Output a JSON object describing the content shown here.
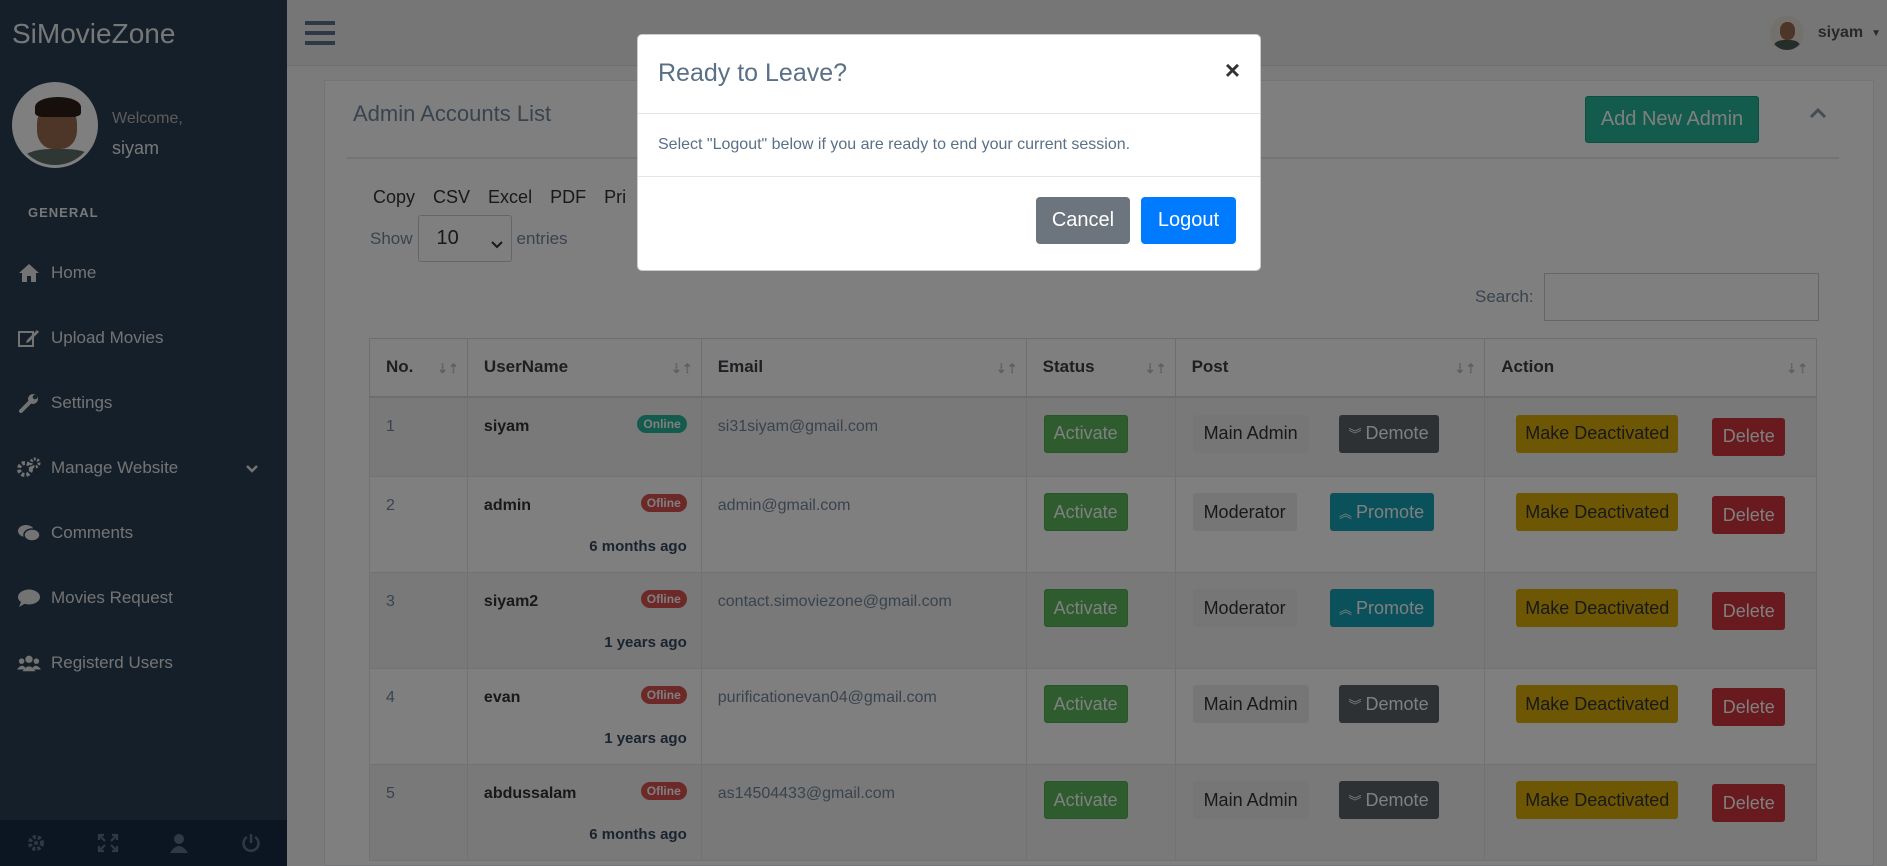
{
  "sidebar": {
    "brand": "SiMovieZone",
    "welcome": "Welcome,",
    "username": "siyam",
    "section_title": "GENERAL",
    "items": [
      {
        "label": "Home",
        "icon": "home-icon"
      },
      {
        "label": "Upload Movies",
        "icon": "edit-icon"
      },
      {
        "label": "Settings",
        "icon": "wrench-icon"
      },
      {
        "label": "Manage Website",
        "icon": "gears-icon"
      },
      {
        "label": "Comments",
        "icon": "comments-icon"
      },
      {
        "label": "Movies Request",
        "icon": "comment-icon"
      },
      {
        "label": "Registerd Users",
        "icon": "users-icon"
      }
    ],
    "footer_icons": [
      "gear-icon",
      "fullscreen-icon",
      "user-icon",
      "power-icon"
    ]
  },
  "topbar": {
    "username": "siyam"
  },
  "panel": {
    "title": "Admin Accounts List",
    "add_button": "Add New Admin",
    "export_buttons": [
      "Copy",
      "CSV",
      "Excel",
      "PDF",
      "Pri"
    ],
    "show_label": "Show",
    "entries_value": "10",
    "entries_label": "entries",
    "search_label": "Search:"
  },
  "table": {
    "headers": [
      "No.",
      "UserName",
      "Email",
      "Status",
      "Post",
      "Action"
    ],
    "rows": [
      {
        "no": "1",
        "username": "siyam",
        "badge": "Online",
        "ago": "",
        "email": "si31siyam@gmail.com",
        "status": "Activate",
        "post": "Main Admin",
        "post_action": "Demote",
        "action1": "Make Deactivated",
        "action2": "Delete"
      },
      {
        "no": "2",
        "username": "admin",
        "badge": "Ofline",
        "ago": "6 months ago",
        "email": "admin@gmail.com",
        "status": "Activate",
        "post": "Moderator",
        "post_action": "Promote",
        "action1": "Make Deactivated",
        "action2": "Delete"
      },
      {
        "no": "3",
        "username": "siyam2",
        "badge": "Ofline",
        "ago": "1 years ago",
        "email": "contact.simoviezone@gmail.com",
        "status": "Activate",
        "post": "Moderator",
        "post_action": "Promote",
        "action1": "Make Deactivated",
        "action2": "Delete"
      },
      {
        "no": "4",
        "username": "evan",
        "badge": "Ofline",
        "ago": "1 years ago",
        "email": "purificationevan04@gmail.com",
        "status": "Activate",
        "post": "Main Admin",
        "post_action": "Demote",
        "action1": "Make Deactivated",
        "action2": "Delete"
      },
      {
        "no": "5",
        "username": "abdussalam",
        "badge": "Ofline",
        "ago": "6 months ago",
        "email": "as14504433@gmail.com",
        "status": "Activate",
        "post": "Main Admin",
        "post_action": "Demote",
        "action1": "Make Deactivated",
        "action2": "Delete"
      }
    ]
  },
  "modal": {
    "title": "Ready to Leave?",
    "close": "×",
    "body": "Select \"Logout\" below if you are ready to end your current session.",
    "cancel": "Cancel",
    "logout": "Logout"
  },
  "colors": {
    "sidebar": "#2a3f54",
    "add_button": "#26B99A",
    "logout_button": "#007bff",
    "cancel_button": "#6c757d"
  }
}
